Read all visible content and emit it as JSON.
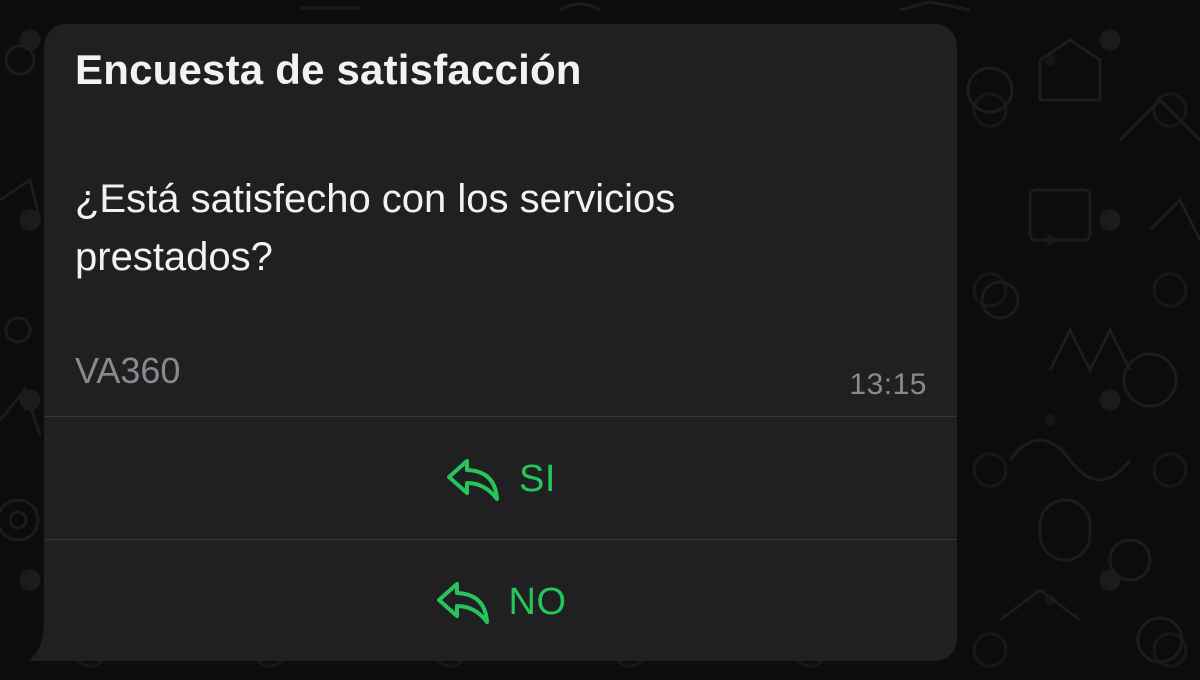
{
  "message": {
    "title": "Encuesta de satisfacción",
    "body": "¿Está satisfecho con los servicios prestados?",
    "footer": "VA360",
    "time": "13:15"
  },
  "buttons": [
    {
      "label": "SI",
      "icon": "reply-icon"
    },
    {
      "label": "NO",
      "icon": "reply-icon"
    }
  ],
  "colors": {
    "background": "#0c0c0c",
    "bubble": "#202022",
    "text": "#f2f2f2",
    "muted": "#8a8a8e",
    "accent": "#25c55b",
    "divider": "#353538"
  }
}
